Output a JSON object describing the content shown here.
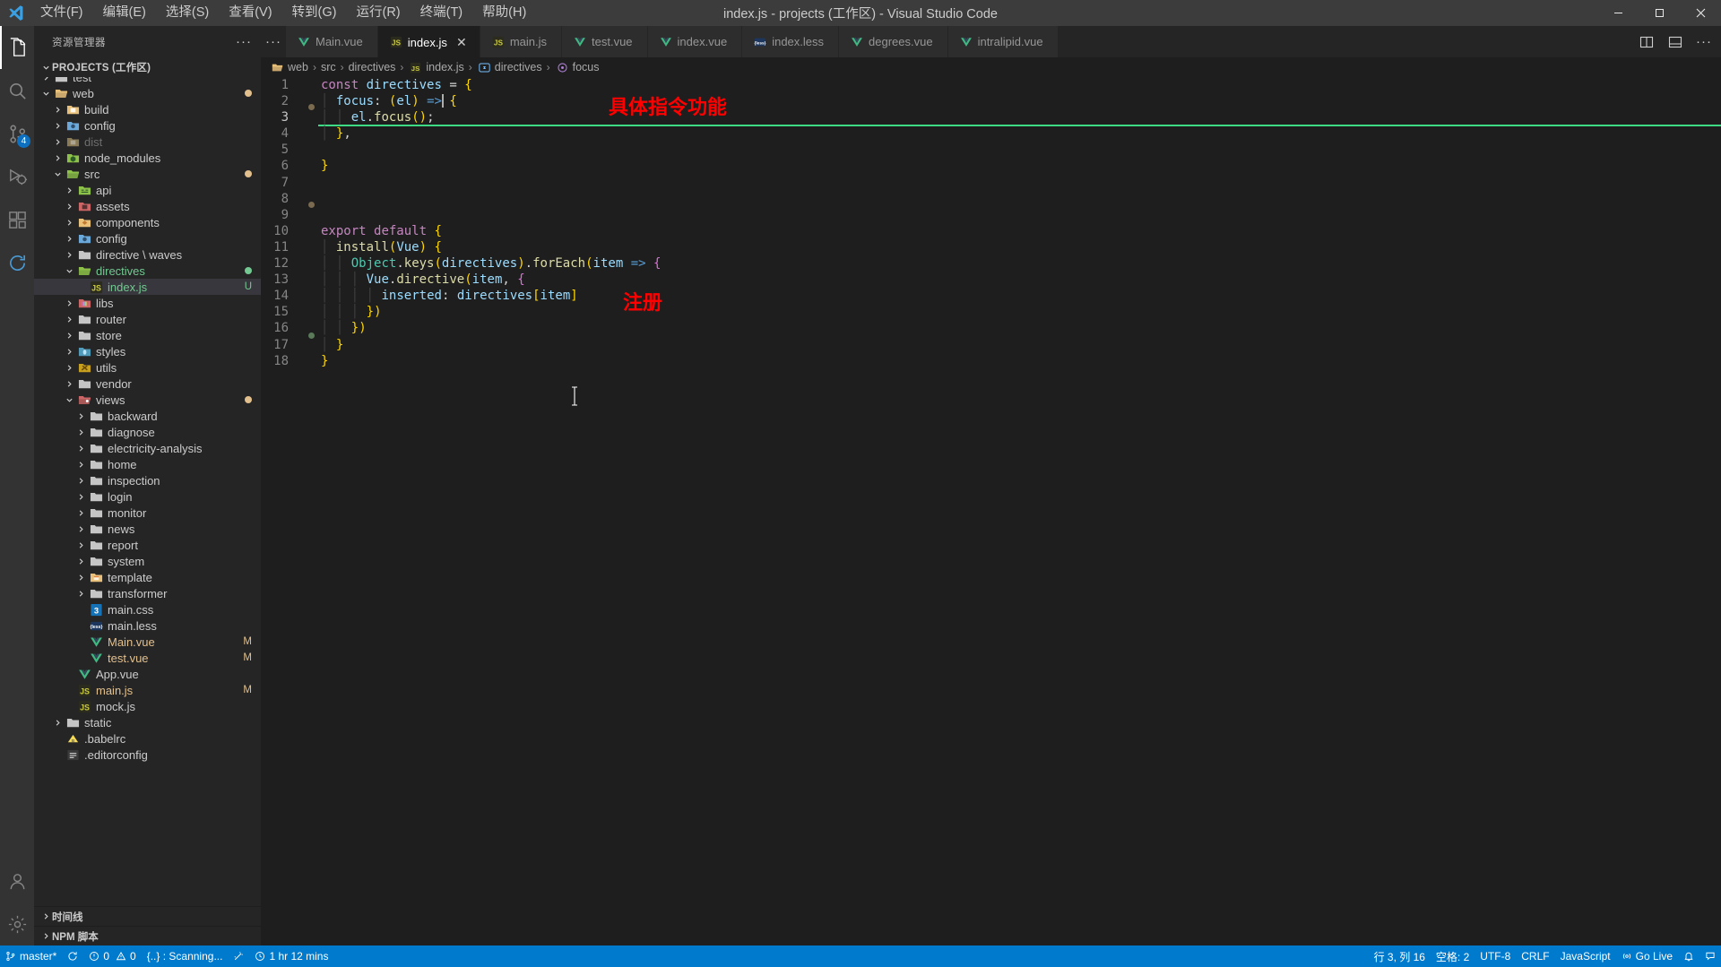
{
  "titlebar": {
    "logo_icon": "vscode-logo-icon",
    "window_title": "index.js - projects (工作区) - Visual Studio Code",
    "menus": [
      {
        "label": "文件(F)",
        "name": "menu-file"
      },
      {
        "label": "编辑(E)",
        "name": "menu-edit"
      },
      {
        "label": "选择(S)",
        "name": "menu-selection"
      },
      {
        "label": "查看(V)",
        "name": "menu-view"
      },
      {
        "label": "转到(G)",
        "name": "menu-go"
      },
      {
        "label": "运行(R)",
        "name": "menu-run"
      },
      {
        "label": "终端(T)",
        "name": "menu-terminal"
      },
      {
        "label": "帮助(H)",
        "name": "menu-help"
      }
    ],
    "window_controls": {
      "minimize": "─",
      "maximize": "☐",
      "close": "✕"
    }
  },
  "activitybar": {
    "items": [
      {
        "name": "activity-explorer",
        "icon": "files-icon",
        "active": true,
        "badge": ""
      },
      {
        "name": "activity-search",
        "icon": "search-icon",
        "active": false,
        "badge": ""
      },
      {
        "name": "activity-source-control",
        "icon": "source-control-icon",
        "active": false,
        "badge": "4"
      },
      {
        "name": "activity-run-debug",
        "icon": "run-debug-icon",
        "active": false,
        "badge": ""
      },
      {
        "name": "activity-extensions",
        "icon": "extensions-icon",
        "active": false,
        "badge": ""
      },
      {
        "name": "activity-sync",
        "icon": "sync-icon",
        "active": false,
        "badge": ""
      }
    ],
    "bottom": [
      {
        "name": "activity-accounts",
        "icon": "account-icon"
      },
      {
        "name": "activity-settings",
        "icon": "gear-icon"
      }
    ]
  },
  "sidebar": {
    "header_title": "资源管理器",
    "more_actions": "···",
    "root_label": "PROJECTS (工作区)",
    "sections": [
      {
        "label": "时间线",
        "name": "sidebar-section-timeline"
      },
      {
        "label": "NPM 脚本",
        "name": "sidebar-section-npm-scripts"
      }
    ],
    "tree": [
      {
        "label": "test",
        "indent": 1,
        "chev": "right",
        "icon": "folder-icon",
        "color": "#c5c5c5",
        "badge": "",
        "dot": ""
      },
      {
        "label": "web",
        "indent": 1,
        "chev": "down",
        "icon": "folder-open-icon",
        "color": "#e8c07a",
        "badge": "",
        "dot": "#e2c08d"
      },
      {
        "label": "build",
        "indent": 2,
        "chev": "right",
        "icon": "folder-build-icon",
        "color": "#c5c5c5",
        "badge": "",
        "dot": ""
      },
      {
        "label": "config",
        "indent": 2,
        "chev": "right",
        "icon": "folder-config-icon",
        "color": "#c5c5c5",
        "badge": "",
        "dot": ""
      },
      {
        "label": "dist",
        "indent": 2,
        "chev": "right",
        "icon": "folder-dist-icon",
        "color": "#7a7a7a",
        "badge": "",
        "dot": ""
      },
      {
        "label": "node_modules",
        "indent": 2,
        "chev": "right",
        "icon": "folder-node-icon",
        "color": "#c5c5c5",
        "badge": "",
        "dot": ""
      },
      {
        "label": "src",
        "indent": 2,
        "chev": "down",
        "icon": "folder-src-icon",
        "color": "#8dc149",
        "badge": "",
        "dot": "#e2c08d"
      },
      {
        "label": "api",
        "indent": 3,
        "chev": "right",
        "icon": "folder-api-icon",
        "color": "#c5c5c5",
        "badge": "",
        "dot": ""
      },
      {
        "label": "assets",
        "indent": 3,
        "chev": "right",
        "icon": "folder-assets-icon",
        "color": "#c5c5c5",
        "badge": "",
        "dot": ""
      },
      {
        "label": "components",
        "indent": 3,
        "chev": "right",
        "icon": "folder-components-icon",
        "color": "#c5c5c5",
        "badge": "",
        "dot": ""
      },
      {
        "label": "config",
        "indent": 3,
        "chev": "right",
        "icon": "folder-config-icon",
        "color": "#c5c5c5",
        "badge": "",
        "dot": ""
      },
      {
        "label": "directive \\ waves",
        "indent": 3,
        "chev": "right",
        "icon": "folder-icon",
        "color": "#c5c5c5",
        "badge": "",
        "dot": ""
      },
      {
        "label": "directives",
        "indent": 3,
        "chev": "down",
        "icon": "folder-open-icon",
        "color": "#8dc149",
        "badge": "",
        "dot": "#73c991"
      },
      {
        "label": "index.js",
        "indent": 4,
        "chev": "none",
        "icon": "js-icon",
        "color": "#cbcb41",
        "badge": "U",
        "dot": "",
        "selected": true,
        "badge_color": "#73c991"
      },
      {
        "label": "libs",
        "indent": 3,
        "chev": "right",
        "icon": "folder-libs-icon",
        "color": "#c5c5c5",
        "badge": "",
        "dot": ""
      },
      {
        "label": "router",
        "indent": 3,
        "chev": "right",
        "icon": "folder-icon",
        "color": "#c5c5c5",
        "badge": "",
        "dot": ""
      },
      {
        "label": "store",
        "indent": 3,
        "chev": "right",
        "icon": "folder-icon",
        "color": "#c5c5c5",
        "badge": "",
        "dot": ""
      },
      {
        "label": "styles",
        "indent": 3,
        "chev": "right",
        "icon": "folder-styles-icon",
        "color": "#c5c5c5",
        "badge": "",
        "dot": ""
      },
      {
        "label": "utils",
        "indent": 3,
        "chev": "right",
        "icon": "folder-utils-icon",
        "color": "#c5c5c5",
        "badge": "",
        "dot": ""
      },
      {
        "label": "vendor",
        "indent": 3,
        "chev": "right",
        "icon": "folder-icon",
        "color": "#c5c5c5",
        "badge": "",
        "dot": ""
      },
      {
        "label": "views",
        "indent": 3,
        "chev": "down",
        "icon": "folder-views-icon",
        "color": "#e8c07a",
        "badge": "",
        "dot": "#e2c08d"
      },
      {
        "label": "backward",
        "indent": 4,
        "chev": "right",
        "icon": "folder-icon",
        "color": "#c5c5c5",
        "badge": "",
        "dot": ""
      },
      {
        "label": "diagnose",
        "indent": 4,
        "chev": "right",
        "icon": "folder-icon",
        "color": "#c5c5c5",
        "badge": "",
        "dot": ""
      },
      {
        "label": "electricity-analysis",
        "indent": 4,
        "chev": "right",
        "icon": "folder-icon",
        "color": "#c5c5c5",
        "badge": "",
        "dot": ""
      },
      {
        "label": "home",
        "indent": 4,
        "chev": "right",
        "icon": "folder-icon",
        "color": "#c5c5c5",
        "badge": "",
        "dot": ""
      },
      {
        "label": "inspection",
        "indent": 4,
        "chev": "right",
        "icon": "folder-icon",
        "color": "#c5c5c5",
        "badge": "",
        "dot": ""
      },
      {
        "label": "login",
        "indent": 4,
        "chev": "right",
        "icon": "folder-icon",
        "color": "#c5c5c5",
        "badge": "",
        "dot": ""
      },
      {
        "label": "monitor",
        "indent": 4,
        "chev": "right",
        "icon": "folder-icon",
        "color": "#c5c5c5",
        "badge": "",
        "dot": ""
      },
      {
        "label": "news",
        "indent": 4,
        "chev": "right",
        "icon": "folder-icon",
        "color": "#c5c5c5",
        "badge": "",
        "dot": ""
      },
      {
        "label": "report",
        "indent": 4,
        "chev": "right",
        "icon": "folder-icon",
        "color": "#c5c5c5",
        "badge": "",
        "dot": ""
      },
      {
        "label": "system",
        "indent": 4,
        "chev": "right",
        "icon": "folder-icon",
        "color": "#c5c5c5",
        "badge": "",
        "dot": ""
      },
      {
        "label": "template",
        "indent": 4,
        "chev": "right",
        "icon": "folder-template-icon",
        "color": "#c5c5c5",
        "badge": "",
        "dot": ""
      },
      {
        "label": "transformer",
        "indent": 4,
        "chev": "right",
        "icon": "folder-icon",
        "color": "#c5c5c5",
        "badge": "",
        "dot": ""
      },
      {
        "label": "main.css",
        "indent": 4,
        "chev": "none",
        "icon": "css-icon",
        "color": "#519aba",
        "badge": "",
        "dot": ""
      },
      {
        "label": "main.less",
        "indent": 4,
        "chev": "none",
        "icon": "less-icon",
        "color": "#2b4c80",
        "badge": "",
        "dot": ""
      },
      {
        "label": "Main.vue",
        "indent": 4,
        "chev": "none",
        "icon": "vue-icon",
        "color": "#41b883",
        "badge": "M",
        "dot": "",
        "badge_color": "#e2c08d",
        "text_color": "#e2c08d"
      },
      {
        "label": "test.vue",
        "indent": 4,
        "chev": "none",
        "icon": "vue-icon",
        "color": "#41b883",
        "badge": "M",
        "dot": "",
        "badge_color": "#e2c08d",
        "text_color": "#e2c08d"
      },
      {
        "label": "App.vue",
        "indent": 3,
        "chev": "none",
        "icon": "vue-icon",
        "color": "#41b883",
        "badge": "",
        "dot": ""
      },
      {
        "label": "main.js",
        "indent": 3,
        "chev": "none",
        "icon": "js-icon",
        "color": "#cbcb41",
        "badge": "M",
        "dot": "",
        "badge_color": "#e2c08d",
        "text_color": "#e2c08d"
      },
      {
        "label": "mock.js",
        "indent": 3,
        "chev": "none",
        "icon": "js-icon",
        "color": "#cbcb41",
        "badge": "",
        "dot": ""
      },
      {
        "label": "static",
        "indent": 2,
        "chev": "right",
        "icon": "folder-icon",
        "color": "#c5c5c5",
        "badge": "",
        "dot": ""
      },
      {
        "label": ".babelrc",
        "indent": 2,
        "chev": "none",
        "icon": "babel-icon",
        "color": "#cbcb41",
        "badge": "",
        "dot": ""
      },
      {
        "label": ".editorconfig",
        "indent": 2,
        "chev": "none",
        "icon": "editorconfig-icon",
        "color": "#c5c5c5",
        "badge": "",
        "dot": ""
      }
    ]
  },
  "tabs": {
    "overflow": "···",
    "items": [
      {
        "label": "Main.vue",
        "icon": "vue-icon",
        "icon_color": "#41b883",
        "active": false,
        "name": "tab-main-vue"
      },
      {
        "label": "index.js",
        "icon": "js-icon",
        "icon_color": "#cbcb41",
        "active": true,
        "name": "tab-index-js",
        "close": "✕"
      },
      {
        "label": "main.js",
        "icon": "js-icon",
        "icon_color": "#cbcb41",
        "active": false,
        "name": "tab-main-js"
      },
      {
        "label": "test.vue",
        "icon": "vue-icon",
        "icon_color": "#41b883",
        "active": false,
        "name": "tab-test-vue"
      },
      {
        "label": "index.vue",
        "icon": "vue-icon",
        "icon_color": "#41b883",
        "active": false,
        "name": "tab-index-vue"
      },
      {
        "label": "index.less",
        "icon": "less-icon",
        "icon_color": "#2b4c80",
        "active": false,
        "name": "tab-index-less"
      },
      {
        "label": "degrees.vue",
        "icon": "vue-icon",
        "icon_color": "#41b883",
        "active": false,
        "name": "tab-degrees-vue"
      },
      {
        "label": "intralipid.vue",
        "icon": "vue-icon",
        "icon_color": "#41b883",
        "active": false,
        "name": "tab-intralipid-vue"
      }
    ],
    "actions": [
      {
        "name": "split-editor-right-button",
        "icon": "split-editor-icon"
      },
      {
        "name": "toggle-panel-button",
        "icon": "layout-panel-icon"
      },
      {
        "name": "more-editor-actions-button",
        "icon": "ellipsis-icon",
        "glyph": "···"
      }
    ]
  },
  "breadcrumb": [
    {
      "label": "web",
      "icon": "folder-open-icon",
      "color": "#e8c07a",
      "name": "breadcrumb-web"
    },
    {
      "label": "src",
      "icon": "",
      "color": "",
      "name": "breadcrumb-src"
    },
    {
      "label": "directives",
      "icon": "",
      "color": "",
      "name": "breadcrumb-directives"
    },
    {
      "label": "index.js",
      "icon": "js-icon",
      "color": "#cbcb41",
      "name": "breadcrumb-index-js"
    },
    {
      "label": "directives",
      "icon": "symbol-object-icon",
      "color": "#75beff",
      "name": "breadcrumb-symbol-directives"
    },
    {
      "label": "focus",
      "icon": "symbol-property-icon",
      "color": "#b180d7",
      "name": "breadcrumb-symbol-focus"
    }
  ],
  "editor": {
    "line_numbers": [
      "1",
      "2",
      "3",
      "4",
      "5",
      "6",
      "7",
      "8",
      "9",
      "10",
      "11",
      "12",
      "13",
      "14",
      "15",
      "16",
      "17",
      "18"
    ],
    "code_text": "const directives = {\n  focus: (el) => {\n    el.focus();\n  },\n\n}\n\n\n\nexport default {\n  install(Vue) {\n    Object.keys(directives).forEach(item => {\n      Vue.directive(item, {\n        inserted: directives[item]\n      })\n    })\n  }\n}",
    "active_line": 3,
    "annotations": [
      {
        "text": "具体指令功能",
        "name": "annotation-directive-feature",
        "color": "#ff0000"
      },
      {
        "text": "注册",
        "name": "annotation-register",
        "color": "#ff0000"
      }
    ]
  },
  "statusbar": {
    "left": [
      {
        "label": "master*",
        "icon": "source-control-icon",
        "name": "status-branch"
      },
      {
        "label": "",
        "icon": "sync-icon",
        "name": "status-sync"
      },
      {
        "label": "0  0",
        "icon": "problems-icon",
        "name": "status-problems",
        "errors": "0",
        "warnings": "0"
      },
      {
        "label": "{..} : Scanning...",
        "icon": "",
        "name": "status-scanning"
      },
      {
        "label": "",
        "icon": "wand-icon",
        "name": "status-wand"
      },
      {
        "label": "1 hr 12 mins",
        "icon": "clock-icon",
        "name": "status-time-tracker"
      }
    ],
    "right": [
      {
        "label": "行 3, 列 16",
        "name": "status-cursor-position"
      },
      {
        "label": "空格: 2",
        "name": "status-indentation"
      },
      {
        "label": "UTF-8",
        "name": "status-encoding"
      },
      {
        "label": "CRLF",
        "name": "status-eol"
      },
      {
        "label": "JavaScript",
        "name": "status-language-mode"
      },
      {
        "label": "Go Live",
        "icon": "broadcast-icon",
        "name": "status-go-live"
      },
      {
        "label": "",
        "icon": "bell-icon",
        "name": "status-notifications"
      },
      {
        "label": "",
        "icon": "feedback-icon",
        "name": "status-feedback"
      }
    ]
  },
  "colors": {
    "accent": "#007acc",
    "editor_bg": "#1e1e1e",
    "sidebar_bg": "#252526",
    "titlebar_bg": "#3c3c3c",
    "annotation_red": "#ff0000",
    "current_line_green": "#3ddc84"
  }
}
